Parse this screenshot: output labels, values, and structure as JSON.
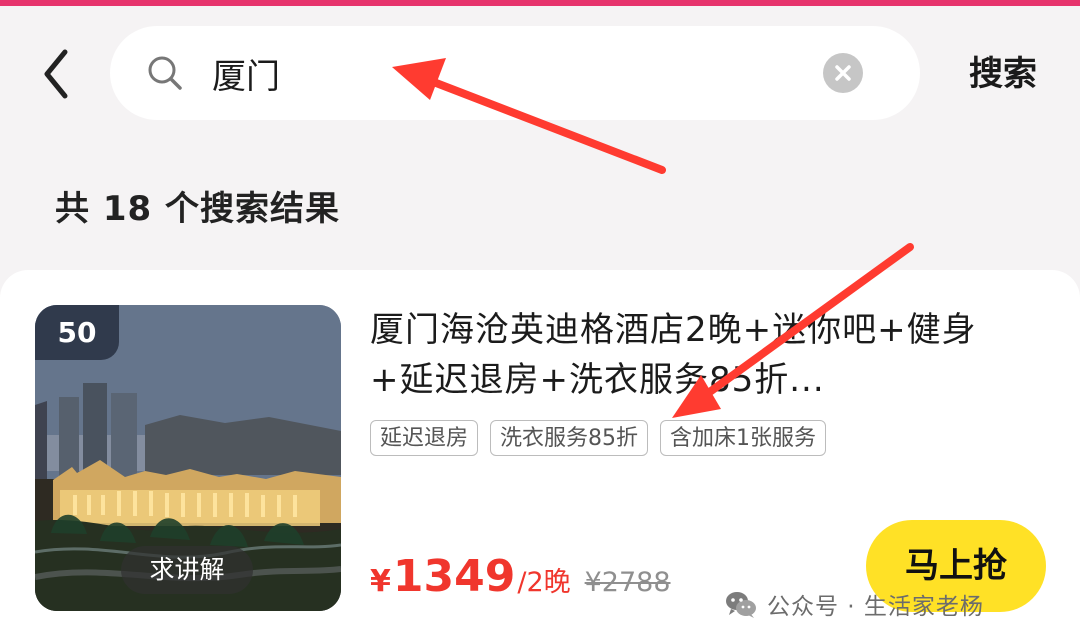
{
  "colors": {
    "accent_red": "#f0362d",
    "button_yellow": "#ffe126",
    "top_border_pink": "#e6336c",
    "annotation_red": "#ff3b30"
  },
  "icons": {
    "back": "chevron-left-icon",
    "search": "search-icon",
    "clear": "close-circle-icon",
    "watermark": "wechat-icon"
  },
  "search": {
    "value": "厦门",
    "submit_label": "搜索"
  },
  "results": {
    "count_text": "共 18 个搜索结果"
  },
  "product": {
    "badge": "50",
    "title": "厦门海沧英迪格酒店2晚+迷你吧+健身+延迟退房+洗衣服务85折...",
    "tags": [
      "延迟退房",
      "洗衣服务85折",
      "含加床1张服务"
    ],
    "image_button": "求讲解",
    "price_symbol": "¥",
    "price": "1349",
    "price_unit": "/2晚",
    "original_price": "¥2788",
    "buy_label": "马上抢"
  },
  "watermark": {
    "text": "公众号 · 生活家老杨"
  }
}
